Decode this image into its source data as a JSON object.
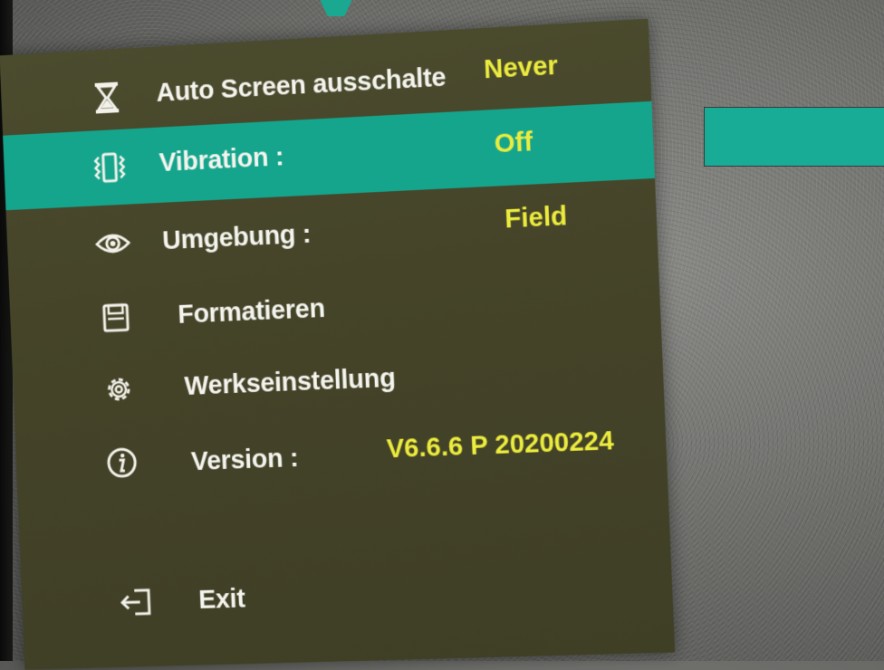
{
  "menu": {
    "items": [
      {
        "label": "Auto Screen ausschalte",
        "value": "Never",
        "icon": "hourglass-icon"
      },
      {
        "label": "Vibration :",
        "value": "Off",
        "icon": "vibration-icon",
        "selected": true
      },
      {
        "label": "Umgebung :",
        "value": "Field",
        "icon": "eye-icon"
      },
      {
        "label": "Formatieren",
        "value": "",
        "icon": "sd-card-icon"
      },
      {
        "label": "Werkseinstellung",
        "value": "",
        "icon": "gear-icon"
      },
      {
        "label": "Version :",
        "value": "V6.6.6 P 20200224",
        "icon": "info-icon"
      },
      {
        "label": "Exit",
        "value": "",
        "icon": "exit-icon"
      }
    ]
  },
  "colors": {
    "panel": "#454429",
    "highlight": "#15a58c",
    "value_text": "#ecec3e",
    "label_text": "#f4f4ee",
    "accent_box": "#18ab95"
  }
}
